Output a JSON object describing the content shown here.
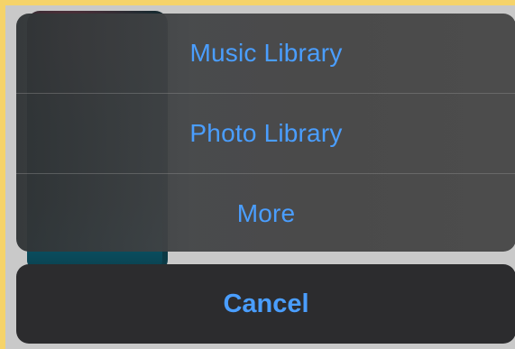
{
  "action_sheet": {
    "items": [
      {
        "label": "Music Library"
      },
      {
        "label": "Photo Library"
      },
      {
        "label": "More"
      }
    ],
    "cancel_label": "Cancel"
  },
  "colors": {
    "accent": "#4a9eff",
    "sheet_background": "#4a4a4a",
    "cancel_background": "#2c2c2e",
    "frame_border": "#f5d36a"
  }
}
